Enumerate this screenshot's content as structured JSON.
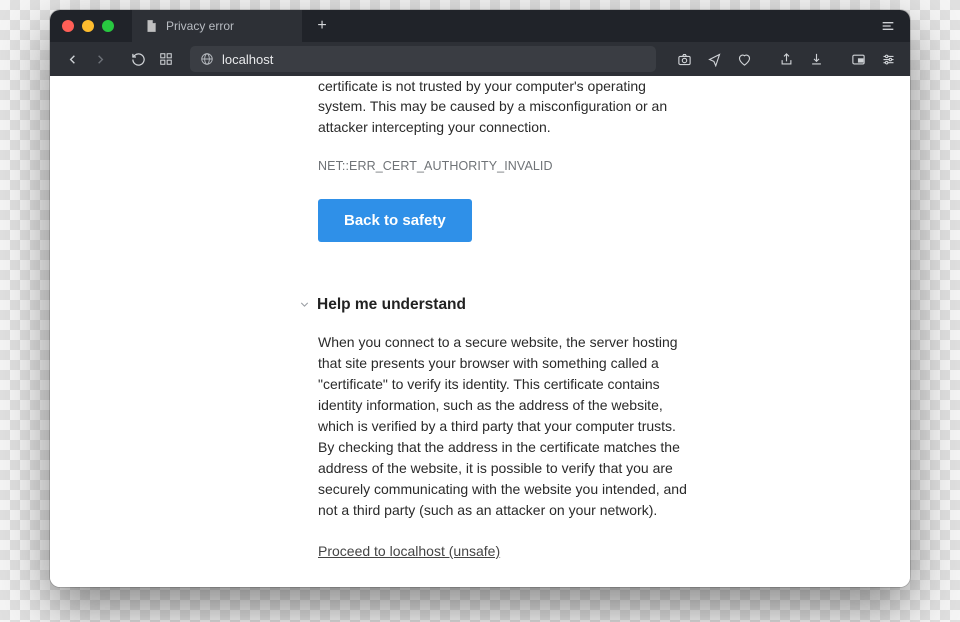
{
  "titlebar": {
    "tab_title": "Privacy error"
  },
  "toolbar": {
    "url": "localhost"
  },
  "page": {
    "cert_paragraph": "certificate is not trusted by your computer's operating system. This may be caused by a misconfiguration or an attacker intercepting your connection.",
    "error_code": "NET::ERR_CERT_AUTHORITY_INVALID",
    "back_to_safety": "Back to safety",
    "help_title": "Help me understand",
    "help_body": "When you connect to a secure website, the server hosting that site presents your browser with something called a \"certificate\" to verify its identity. This certificate contains identity information, such as the address of the website, which is verified by a third party that your computer trusts. By checking that the address in the certificate matches the address of the website, it is possible to verify that you are securely communicating with the website you intended, and not a third party (such as an attacker on your network).",
    "proceed_link": "Proceed to localhost (unsafe)"
  }
}
